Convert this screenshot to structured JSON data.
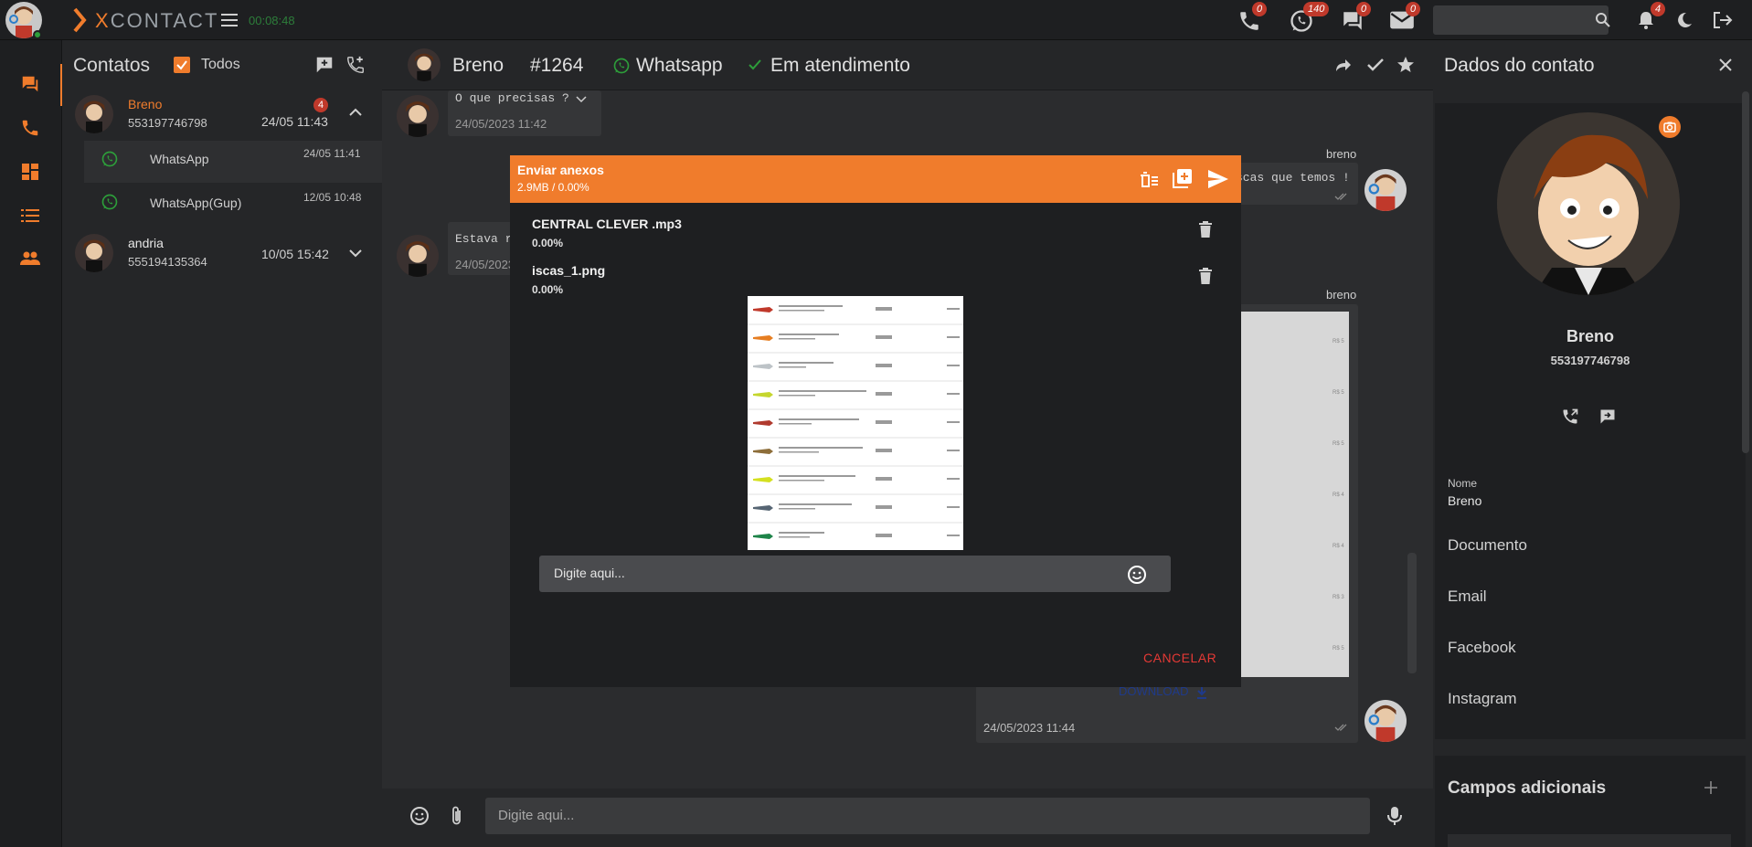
{
  "topbar": {
    "brand": "XCONTACT",
    "timer": "00:08:48",
    "badges": {
      "phone": "0",
      "whatsapp": "140",
      "chat": "0",
      "mail": "0",
      "notifications": "4"
    },
    "icons": [
      "menu-icon",
      "phone-icon",
      "whatsapp-icon",
      "chat-icon",
      "mail-icon",
      "search-icon",
      "bell-icon",
      "moon-icon",
      "logout-icon"
    ]
  },
  "rail": {
    "icons": [
      "chat-icon",
      "phone-icon",
      "dashboard-icon",
      "list-icon",
      "people-icon"
    ]
  },
  "contacts": {
    "title": "Contatos",
    "filter_label": "Todos",
    "items": [
      {
        "name": "Breno",
        "phone": "553197746798",
        "time": "24/05 11:43",
        "unread": "4",
        "channels": [
          {
            "label": "WhatsApp",
            "time": "24/05 11:41"
          },
          {
            "label": "WhatsApp(Gup)",
            "time": "12/05 10:48"
          }
        ]
      },
      {
        "name": "andria",
        "phone": "555194135364",
        "time": "10/05 15:42"
      }
    ]
  },
  "chat": {
    "contact": "Breno",
    "ticket": "#1264",
    "channel": "Whatsapp",
    "status": "Em atendimento",
    "messages": [
      {
        "text": "O que precisas ?",
        "date": "24/05/2023 11:42"
      },
      {
        "sender": "breno",
        "text": "scas que temos !"
      },
      {
        "text": "Estava r",
        "date": "24/05/2023"
      },
      {
        "sender": "breno",
        "download": "DOWNLOAD",
        "date": "24/05/2023 11:44"
      }
    ],
    "input_placeholder": "Digite aqui..."
  },
  "modal": {
    "title": "Enviar anexos",
    "size": "2.9MB / 0.00%",
    "files": [
      {
        "name": "CENTRAL CLEVER .mp3",
        "progress": "0.00%"
      },
      {
        "name": "iscas_1.png",
        "progress": "0.00%"
      }
    ],
    "caption_placeholder": "Digite aqui...",
    "cancel": "CANCELAR"
  },
  "contact_panel": {
    "title": "Dados do contato",
    "name": "Breno",
    "phone": "553197746798",
    "fields": {
      "nome_label": "Nome",
      "nome_value": "Breno",
      "documento": "Documento",
      "email": "Email",
      "facebook": "Facebook",
      "instagram": "Instagram"
    },
    "extra_title": "Campos adicionais"
  },
  "colors": {
    "accent": "#f07c2c",
    "badge": "#c0392b",
    "online": "#2d9d3a",
    "danger": "#e53935",
    "link": "#1f3a8a"
  }
}
